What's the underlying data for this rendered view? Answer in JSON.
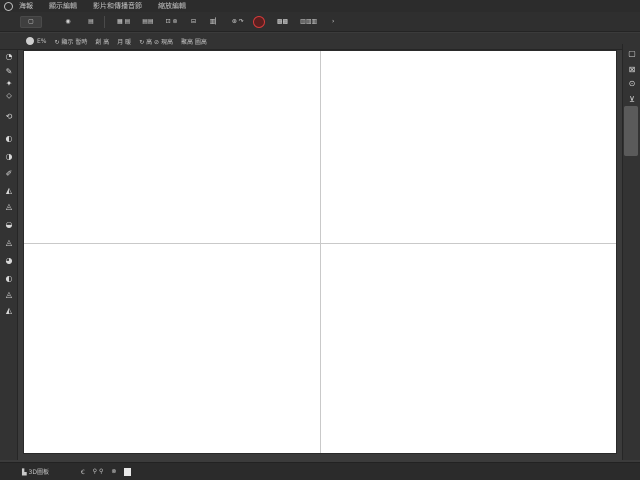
{
  "menubar": {
    "items": [
      "海報",
      "顯示編輯",
      "影片和傳播音節",
      "縮放編輯"
    ]
  },
  "toolbar": {
    "groups": [
      {
        "label": "▢"
      },
      {
        "label": "◉"
      },
      {
        "label": "▤"
      },
      {
        "label": "▦ ▤"
      },
      {
        "label": "▤▤"
      },
      {
        "label": "⊡ ⊚"
      },
      {
        "label": "⊟"
      },
      {
        "label": "▥▏"
      },
      {
        "label": "⊛ ↷"
      },
      {
        "label": "▩▩"
      },
      {
        "label": "▥▥▥"
      },
      {
        "label": "›"
      }
    ]
  },
  "options_bar": {
    "items": [
      "E%",
      "↻ 顯示 暫時",
      "創 高",
      "月 暖",
      "↻ 高 ⊘ 現高",
      "聚高 圖高"
    ]
  },
  "left_tools": [
    "◔",
    "✎",
    "✦",
    "⬦",
    "⟲",
    "◐",
    "◑",
    "✐",
    "◭",
    "◬",
    "◒",
    "◬",
    "◕",
    "◐",
    "◬",
    "◭"
  ],
  "right_tools": [
    "▢",
    "⊠",
    "⊙",
    "⊻"
  ],
  "status_bar": {
    "items": [
      "▙ 3D圖板",
      "Ꞓ",
      "⚲ ⚲",
      "⊗"
    ]
  }
}
